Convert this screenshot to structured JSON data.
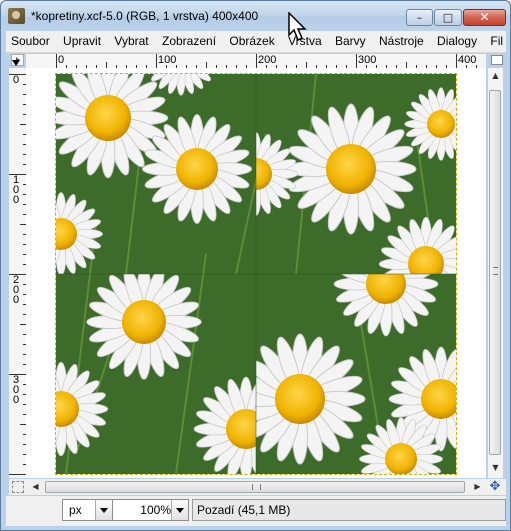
{
  "window": {
    "title": "*kopretiny.xcf-5.0 (RGB, 1 vrstva) 400x400",
    "minimize_glyph": "–",
    "maximize_glyph": "□",
    "close_glyph": "✕"
  },
  "menubar": {
    "items": [
      "Soubor",
      "Upravit",
      "Vybrat",
      "Zobrazení",
      "Obrázek",
      "Vrstva",
      "Barvy",
      "Nástroje",
      "Dialogy",
      "Fil"
    ]
  },
  "rulers": {
    "horizontal": [
      "0",
      "100",
      "200",
      "300",
      "400"
    ],
    "vertical": [
      "0",
      "100",
      "200",
      "300"
    ]
  },
  "statusbar": {
    "unit": "px",
    "zoom": "100%",
    "status": "Pozadí (45,1 MB)"
  },
  "colors": {
    "selection_outline": "#c8b400",
    "daisy_center": "#f0b400",
    "grass": "#3d6b2a"
  }
}
